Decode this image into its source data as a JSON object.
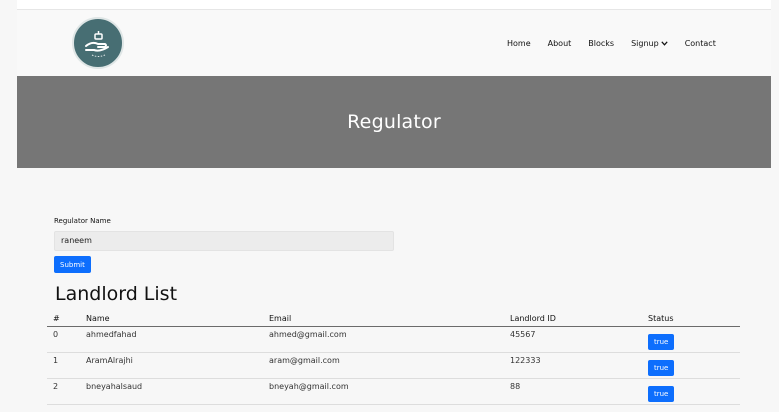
{
  "nav": {
    "items": [
      "Home",
      "About",
      "Blocks",
      "Signup",
      "Contact"
    ]
  },
  "hero": {
    "title": "Regulator"
  },
  "form": {
    "label": "Regulator Name",
    "value": "raneem",
    "submit_label": "Submit"
  },
  "list": {
    "title": "Landlord List",
    "headers": [
      "#",
      "Name",
      "Email",
      "Landlord ID",
      "Status"
    ],
    "rows": [
      {
        "index": "0",
        "name": "ahmedfahad",
        "email": "ahmed@gmail.com",
        "id": "45567",
        "status": "true"
      },
      {
        "index": "1",
        "name": "AramAlrajhi",
        "email": "aram@gmail.com",
        "id": "122333",
        "status": "true"
      },
      {
        "index": "2",
        "name": "bneyahalsaud",
        "email": "bneyah@gmail.com",
        "id": "88",
        "status": "true"
      }
    ]
  },
  "colors": {
    "accent": "#0d6efd",
    "hero_bg": "#767676",
    "logo_bg": "#476e73"
  }
}
